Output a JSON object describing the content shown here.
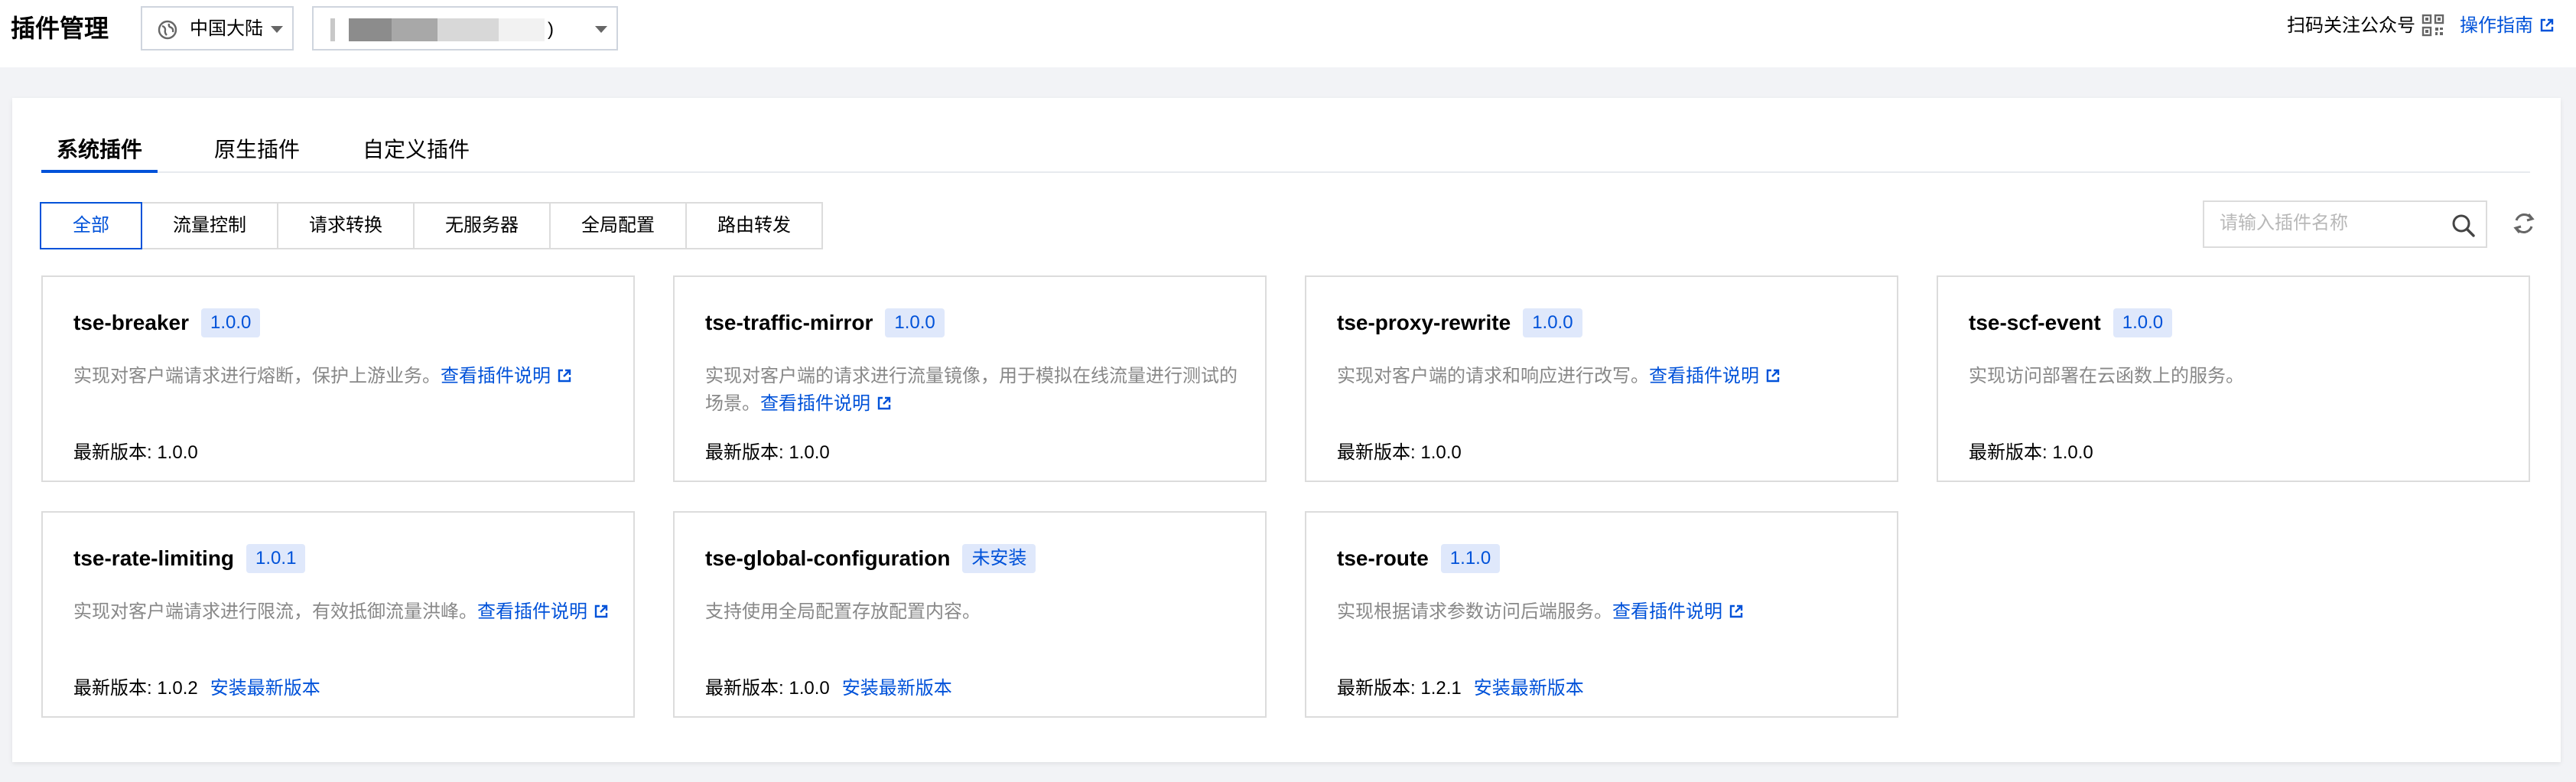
{
  "header": {
    "title": "插件管理",
    "region": "中国大陆",
    "instance_suffix": ")",
    "qr_text": "扫码关注公众号",
    "guide_link": "操作指南"
  },
  "tabs": [
    {
      "label": "系统插件",
      "active": true
    },
    {
      "label": "原生插件",
      "active": false
    },
    {
      "label": "自定义插件",
      "active": false
    }
  ],
  "filters": [
    {
      "label": "全部",
      "active": true
    },
    {
      "label": "流量控制",
      "active": false
    },
    {
      "label": "请求转换",
      "active": false
    },
    {
      "label": "无服务器",
      "active": false
    },
    {
      "label": "全局配置",
      "active": false
    },
    {
      "label": "路由转发",
      "active": false
    }
  ],
  "search": {
    "placeholder": "请输入插件名称",
    "value": ""
  },
  "labels": {
    "latest_version": "最新版本: ",
    "install_latest": "安装最新版本",
    "view_docs": "查看插件说明"
  },
  "plugins": [
    {
      "name": "tse-breaker",
      "badge": "1.0.0",
      "desc": "实现对客户端请求进行熔断，保护上游业务。",
      "has_doc": true,
      "latest": "1.0.0",
      "can_install": false
    },
    {
      "name": "tse-traffic-mirror",
      "badge": "1.0.0",
      "desc": "实现对客户端的请求进行流量镜像，用于模拟在线流量进行测试的场景。",
      "has_doc": true,
      "latest": "1.0.0",
      "can_install": false
    },
    {
      "name": "tse-proxy-rewrite",
      "badge": "1.0.0",
      "desc": "实现对客户端的请求和响应进行改写。",
      "has_doc": true,
      "latest": "1.0.0",
      "can_install": false
    },
    {
      "name": "tse-scf-event",
      "badge": "1.0.0",
      "desc": "实现访问部署在云函数上的服务。",
      "has_doc": false,
      "latest": "1.0.0",
      "can_install": false
    },
    {
      "name": "tse-rate-limiting",
      "badge": "1.0.1",
      "desc": "实现对客户端请求进行限流，有效抵御流量洪峰。",
      "has_doc": true,
      "latest": "1.0.2",
      "can_install": true
    },
    {
      "name": "tse-global-configuration",
      "badge": "未安装",
      "desc": "支持使用全局配置存放配置内容。",
      "has_doc": false,
      "latest": "1.0.0",
      "can_install": true
    },
    {
      "name": "tse-route",
      "badge": "1.1.0",
      "desc": "实现根据请求参数访问后端服务。",
      "has_doc": true,
      "latest": "1.2.1",
      "can_install": true
    }
  ],
  "colors": {
    "accent": "#0052d9",
    "badge_bg": "#dfe8fb",
    "border": "#dcdcdc"
  }
}
